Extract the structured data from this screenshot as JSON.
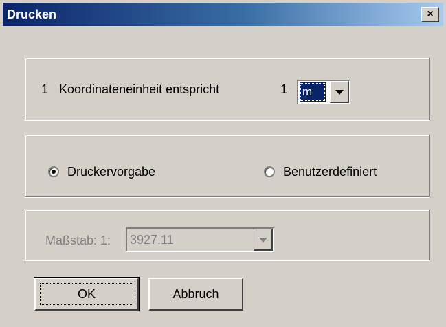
{
  "window": {
    "title": "Drucken",
    "close_label": "×"
  },
  "unit_group": {
    "left_number": "1",
    "label": "Koordinateneinheit entspricht",
    "right_number": "1",
    "unit_selected": "m"
  },
  "radio_group": {
    "option_default": "Druckervorgabe",
    "option_custom": "Benutzerdefiniert",
    "selected": "Druckervorgabe"
  },
  "scale_group": {
    "label": "Maßstab: 1:",
    "value": "3927.11"
  },
  "buttons": {
    "ok": "OK",
    "cancel": "Abbruch"
  }
}
